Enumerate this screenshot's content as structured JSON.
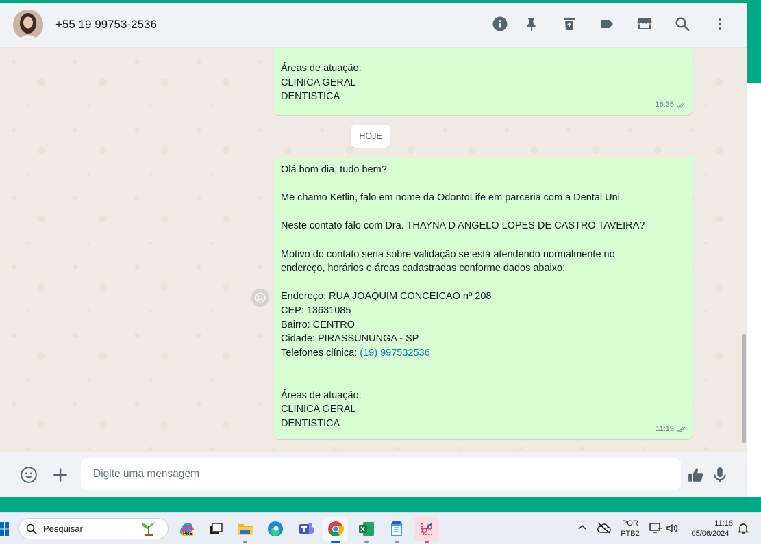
{
  "header": {
    "contact_name": "+55 19 99753-2536",
    "icons": [
      "info-icon",
      "pin-icon",
      "delete-icon",
      "label-icon",
      "store-icon",
      "search-icon",
      "menu-icon"
    ]
  },
  "chat": {
    "message_1": {
      "lines": [
        "Áreas de atuação:",
        "CLINICA GERAL",
        "DENTISTICA"
      ],
      "time": "16:35"
    },
    "date_chip": "HOJE",
    "message_2": {
      "lines": [
        "Olá bom dia, tudo bem?",
        "",
        "Me chamo Ketlin, falo em nome da OdontoLife em parceria com a Dental Uni.",
        "",
        "Neste contato falo com Dra. THAYNA D ANGELO LOPES DE CASTRO TAVEIRA?",
        "",
        "Motivo do contato seria sobre validação se está atendendo normalmente no",
        "endereço, horários e áreas cadastradas conforme dados abaixo:",
        "",
        "Endereço: RUA JOAQUIM CONCEICAO nº 208",
        "CEP: 13631085",
        "Bairro: CENTRO",
        "Cidade: PIRASSUNUNGA - SP"
      ],
      "phone_label": "Telefones clínica: ",
      "phone_link": "(19) 997532536",
      "tail_lines": [
        "Áreas de atuação:",
        "CLINICA GERAL",
        "DENTISTICA"
      ],
      "time": "11:19"
    }
  },
  "composer": {
    "placeholder": "Digite uma mensagem"
  },
  "taskbar": {
    "search_label": "Pesquisar",
    "lang_top": "POR",
    "lang_bottom": "PTB2",
    "time": "11:18",
    "date": "05/06/2024",
    "copilot_badge": "PRE"
  },
  "colors": {
    "accent": "#00a884",
    "outgoing_bubble": "#d9fdd3",
    "link": "#027eb5"
  }
}
